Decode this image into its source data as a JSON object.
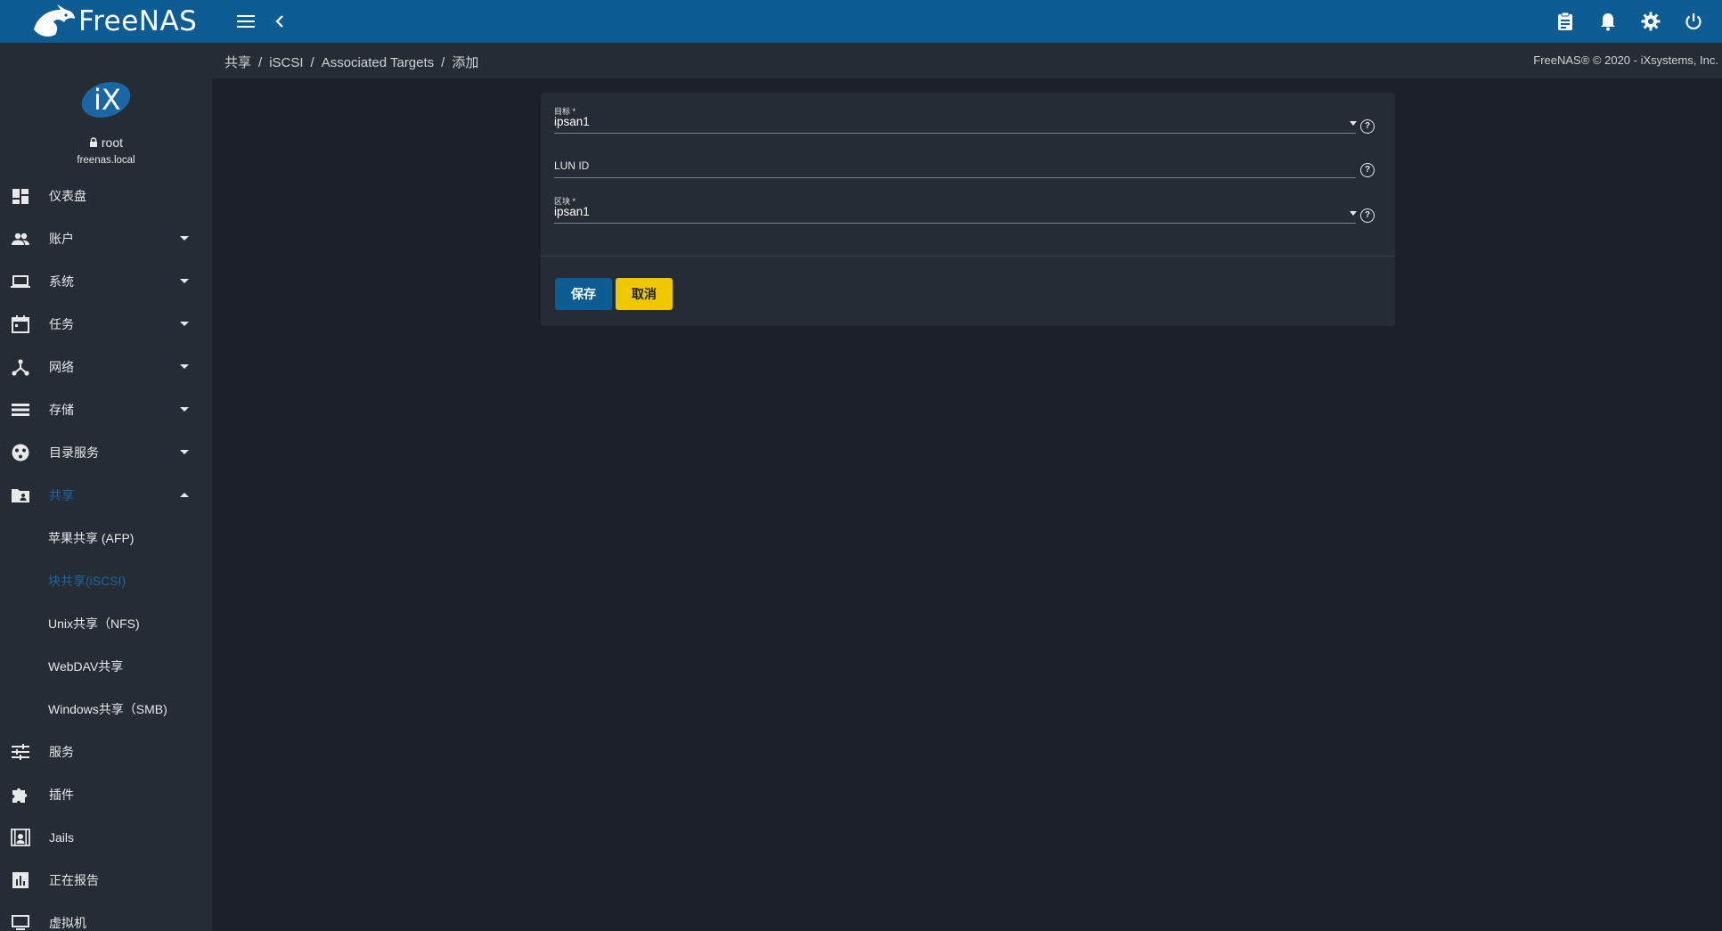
{
  "app": {
    "name": "FreeNAS"
  },
  "profile": {
    "logo_text": "iX",
    "user": "root",
    "host": "freenas.local"
  },
  "sidebar": {
    "items": [
      {
        "label": "仪表盘"
      },
      {
        "label": "账户"
      },
      {
        "label": "系统"
      },
      {
        "label": "任务"
      },
      {
        "label": "网络"
      },
      {
        "label": "存储"
      },
      {
        "label": "目录服务"
      },
      {
        "label": "共享"
      },
      {
        "label": "服务"
      },
      {
        "label": "插件"
      },
      {
        "label": "Jails"
      },
      {
        "label": "正在报告"
      },
      {
        "label": "虚拟机"
      }
    ],
    "sharing_sub": [
      {
        "label": "苹果共享 (AFP)"
      },
      {
        "label": "块共享(iSCSI)"
      },
      {
        "label": "Unix共享（NFS)"
      },
      {
        "label": "WebDAV共享"
      },
      {
        "label": "Windows共享（SMB)"
      }
    ]
  },
  "breadcrumb": {
    "items": [
      "共享",
      "iSCSI",
      "Associated Targets",
      "添加"
    ],
    "separator": "/"
  },
  "copyright": "FreeNAS® © 2020 - iXsystems, Inc.",
  "form": {
    "target": {
      "label": "目标 *",
      "value": "ipsan1"
    },
    "lun_id": {
      "label": "LUN ID",
      "value": ""
    },
    "extent": {
      "label": "区块 *",
      "value": "ipsan1"
    },
    "help_glyph": "?",
    "save_label": "保存",
    "cancel_label": "取消"
  },
  "colors": {
    "topbar": "#0d5c94",
    "sidebar": "#262c34",
    "background": "#1b2029",
    "accent": "#1a67a6",
    "cancel": "#f0c800"
  }
}
